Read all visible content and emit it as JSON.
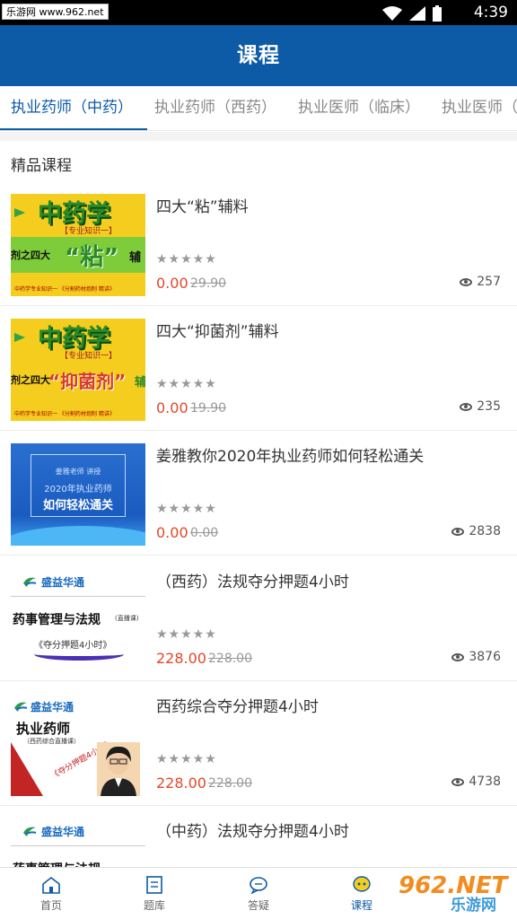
{
  "status_bar": {
    "watermark": "乐游网 www.962.net",
    "time": "4:39"
  },
  "app_bar": {
    "title": "课程"
  },
  "tabs": [
    {
      "label": "执业药师（中药）"
    },
    {
      "label": "执业药师（西药）"
    },
    {
      "label": "执业医师（临床）"
    },
    {
      "label": "执业医师（"
    }
  ],
  "section": {
    "title": "精品课程"
  },
  "courses": [
    {
      "title": "四大“粘”辅料",
      "price": "0.00",
      "original_price": "29.90",
      "views": "257",
      "rating_stars": 5,
      "thumb": {
        "heading": "中药学",
        "sub": "【专业知识一】",
        "left": "剂之四大",
        "highlight": "“粘”",
        "right": "辅",
        "footer": "中药学专业知识一 《分割药材炮制 精讲》"
      }
    },
    {
      "title": "四大“抑菌剂”辅料",
      "price": "0.00",
      "original_price": "19.90",
      "views": "235",
      "rating_stars": 5,
      "thumb": {
        "heading": "中药学",
        "sub": "【专业知识一】",
        "left": "剂之四大",
        "highlight": "“抑菌剂”",
        "right": "辅",
        "footer": "中药学专业知识一 《分割药材炮制 精讲》"
      }
    },
    {
      "title": "姜雅教你2020年执业药师如何轻松通关",
      "price": "0.00",
      "original_price": "0.00",
      "views": "2838",
      "rating_stars": 5,
      "thumb": {
        "line1": "姜雅老师 讲授",
        "line2": "2020年执业药师",
        "line3": "如何轻松通关"
      }
    },
    {
      "title": "（西药）法规夺分押题4小时",
      "price": "228.00",
      "original_price": "228.00",
      "views": "3876",
      "rating_stars": 5,
      "thumb": {
        "logo": "盛益华通",
        "heading": "药事管理与法规",
        "badge": "(直播课)",
        "tag": "《夺分押题4小时》"
      }
    },
    {
      "title": "西药综合夺分押题4小时",
      "price": "228.00",
      "original_price": "228.00",
      "views": "4738",
      "rating_stars": 5,
      "thumb": {
        "logo": "盛益华通",
        "heading": "执业药师",
        "sub": "（西药综合直播课）",
        "tag": "《夺分押题4小时》"
      }
    },
    {
      "title": "（中药）法规夺分押题4小时",
      "price": "",
      "original_price": "",
      "views": "",
      "rating_stars": 0,
      "thumb": {
        "logo": "盛益华通",
        "heading": "药事管理与法规"
      }
    }
  ],
  "bottom_nav": [
    {
      "label": "首页",
      "icon": "home-icon"
    },
    {
      "label": "题库",
      "icon": "question-bank-icon"
    },
    {
      "label": "答疑",
      "icon": "chat-icon"
    },
    {
      "label": "课程",
      "icon": "course-icon",
      "active": true
    }
  ],
  "brand_watermark": {
    "number": "962.NET",
    "name": "乐游网"
  },
  "colors": {
    "primary": "#0d5aa7",
    "price": "#e1492a",
    "stars": "#999999",
    "background_gap": "#f3f3f3"
  }
}
